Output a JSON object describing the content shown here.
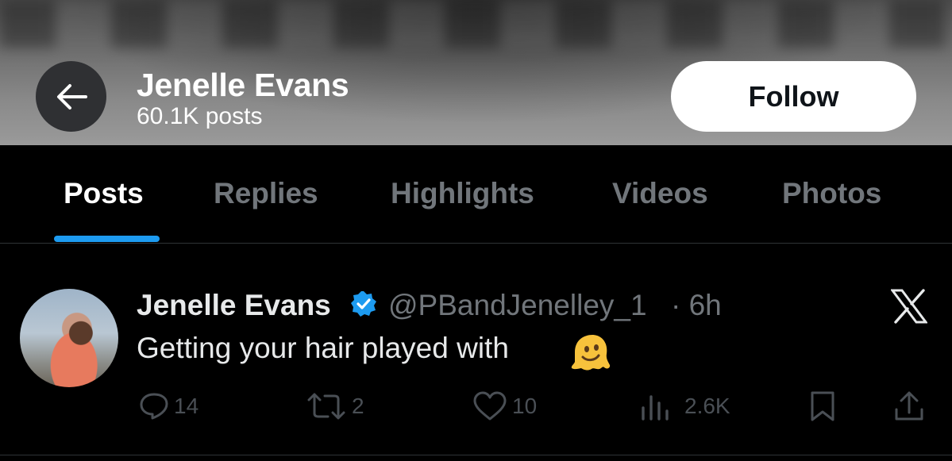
{
  "header": {
    "name": "Jenelle Evans",
    "post_count": "60.1K posts",
    "follow_label": "Follow",
    "back_icon": "arrow-left-icon"
  },
  "tabs": [
    {
      "label": "Posts",
      "active": true
    },
    {
      "label": "Replies",
      "active": false
    },
    {
      "label": "Highlights",
      "active": false
    },
    {
      "label": "Videos",
      "active": false
    },
    {
      "label": "Photos",
      "active": false
    }
  ],
  "post": {
    "author_name": "Jenelle Evans",
    "verified": true,
    "handle": "@PBandJenelley_1",
    "time": "· 6h",
    "text": "Getting your hair played with",
    "emoji": "melting-face",
    "actions": {
      "replies": "14",
      "reposts": "2",
      "likes": "10",
      "views": "2.6K"
    }
  },
  "colors": {
    "accent": "#1d9bf0",
    "background": "#000000",
    "muted_text": "#71767b",
    "action_icons": "#4a4f55"
  }
}
